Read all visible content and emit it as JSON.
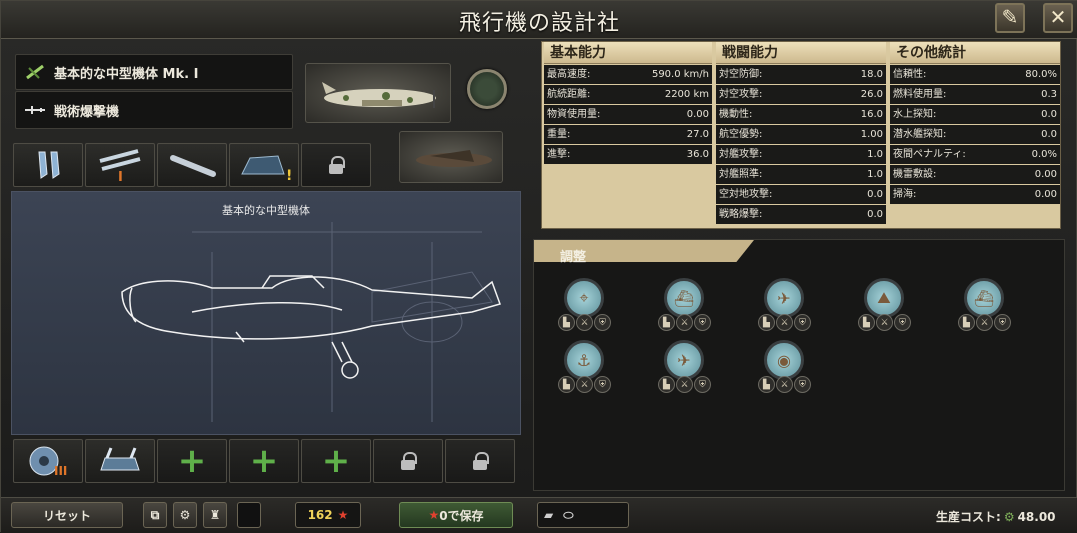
{
  "window": {
    "title": "飛行機の設計社",
    "close_icon": "close-x-icon",
    "edit_icon": "rename-pen-icon"
  },
  "design": {
    "name": "基本的な中型機体 Mk. I",
    "role": "戦術爆撃機",
    "blueprint_label": "基本的な中型機体"
  },
  "top_modules": [
    {
      "icon": "engine-bombs-icon",
      "badge": ""
    },
    {
      "icon": "twin-bombs-icon",
      "badge": "I"
    },
    {
      "icon": "torpedo-icon",
      "badge": ""
    },
    {
      "icon": "armor-cannon-icon",
      "badge": "!"
    },
    {
      "icon": "lock-icon",
      "badge": ""
    }
  ],
  "bottom_modules": [
    {
      "icon": "radial-engine-icon",
      "badge": "III"
    },
    {
      "icon": "gun-turret-icon",
      "badge": ""
    },
    {
      "icon": "add-icon",
      "badge": ""
    },
    {
      "icon": "add-icon",
      "badge": ""
    },
    {
      "icon": "add-icon",
      "badge": ""
    },
    {
      "icon": "lock-icon",
      "badge": ""
    },
    {
      "icon": "lock-icon",
      "badge": ""
    }
  ],
  "stats": {
    "basic": {
      "header": "基本能力",
      "rows": [
        {
          "label": "最高速度:",
          "value": "590.0 km/h"
        },
        {
          "label": "航続距離:",
          "value": "2200 km"
        },
        {
          "label": "物資使用量:",
          "value": "0.00"
        },
        {
          "label": "重量:",
          "value": "27.0"
        },
        {
          "label": "進撃:",
          "value": "36.0"
        }
      ]
    },
    "combat": {
      "header": "戦闘能力",
      "rows": [
        {
          "label": "対空防御:",
          "value": "18.0"
        },
        {
          "label": "対空攻撃:",
          "value": "26.0"
        },
        {
          "label": "機動性:",
          "value": "16.0"
        },
        {
          "label": "航空優勢:",
          "value": "1.00"
        },
        {
          "label": "対艦攻撃:",
          "value": "1.0"
        },
        {
          "label": "対艦照準:",
          "value": "1.0"
        },
        {
          "label": "空対地攻撃:",
          "value": "0.0"
        },
        {
          "label": "戦略爆撃:",
          "value": "0.0"
        }
      ]
    },
    "other": {
      "header": "その他統計",
      "rows": [
        {
          "label": "信頼性:",
          "value": "80.0%"
        },
        {
          "label": "燃料使用量:",
          "value": "0.3"
        },
        {
          "label": "水上探知:",
          "value": "0.0"
        },
        {
          "label": "潜水艦探知:",
          "value": "0.0"
        },
        {
          "label": "夜間ペナルティ:",
          "value": "0.0%"
        },
        {
          "label": "機雷敷設:",
          "value": "0.00"
        },
        {
          "label": "掃海:",
          "value": "0.00"
        }
      ]
    }
  },
  "adjust": {
    "title": "調整",
    "items": [
      {
        "icon": "cas-target-icon",
        "mods": [
          "boot",
          "sword",
          "shield"
        ]
      },
      {
        "icon": "naval-strike-icon",
        "mods": [
          "boot",
          "sword",
          "shield"
        ]
      },
      {
        "icon": "air-superiority-icon",
        "mods": [
          "boot",
          "sword",
          "shield"
        ]
      },
      {
        "icon": "ground-attack-icon",
        "mods": [
          "boot",
          "sword",
          "shield"
        ]
      },
      {
        "icon": "warship-icon",
        "mods": [
          "boot",
          "sword",
          "shield"
        ]
      },
      {
        "icon": "anchor-target-icon",
        "mods": [
          "boot",
          "sword",
          "shield"
        ]
      },
      {
        "icon": "bomber-icon",
        "mods": [
          "boot",
          "sword",
          "shield"
        ]
      },
      {
        "icon": "recon-icon",
        "mods": [
          "boot",
          "sword",
          "shield"
        ]
      }
    ]
  },
  "bottom_bar": {
    "reset_label": "リセット",
    "xp_value": "162",
    "save_label": "0で保存",
    "cost_label": "生産コスト:",
    "cost_value": "48.00"
  },
  "colors": {
    "accent_tan": "#d9c9a0",
    "plus_green": "#5fb04a",
    "xp_yellow": "#f0d35a",
    "star_red": "#e0412f"
  }
}
